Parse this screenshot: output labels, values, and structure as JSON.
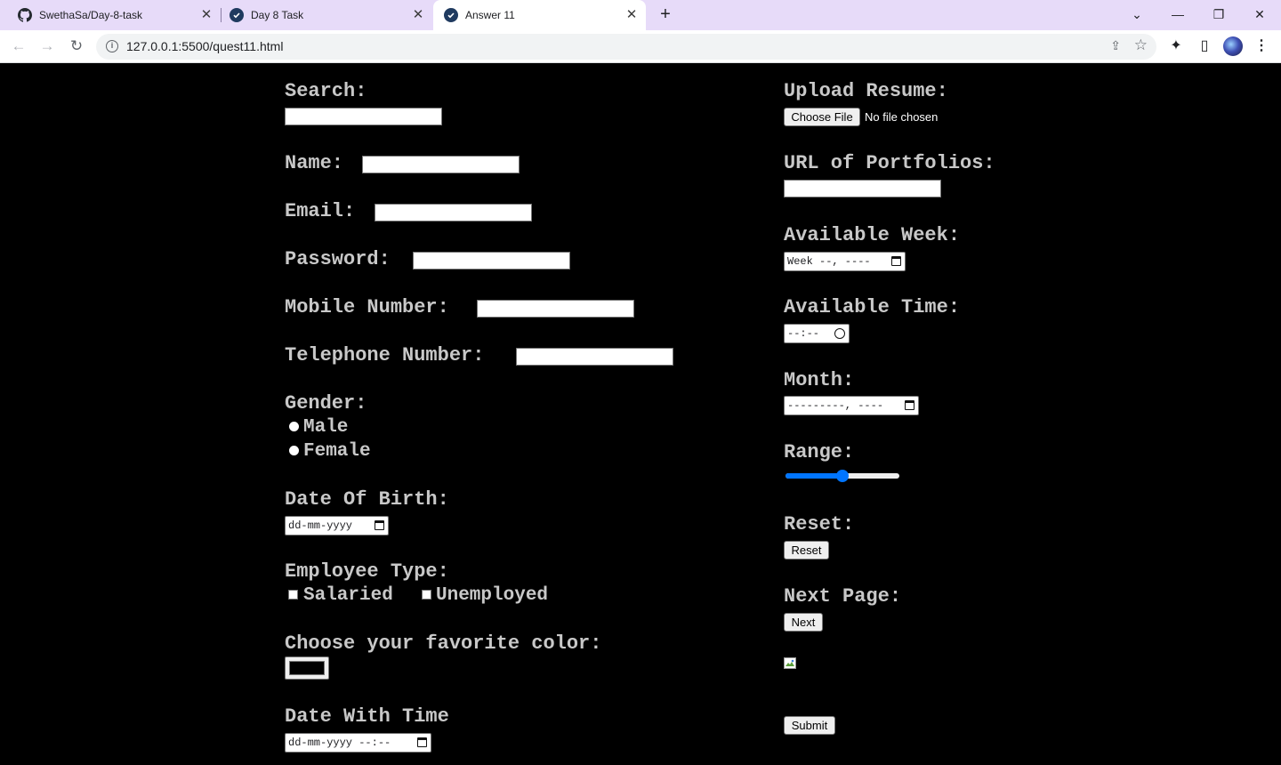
{
  "browser": {
    "tabs": [
      {
        "title": "SwethaSa/Day-8-task",
        "active": false
      },
      {
        "title": "Day 8 Task",
        "active": false
      },
      {
        "title": "Answer 11",
        "active": true
      }
    ],
    "url": "127.0.0.1:5500/quest11.html",
    "accent": "#e7dbf9"
  },
  "form": {
    "search_label": "Search:",
    "name_label": "Name:",
    "email_label": "Email:",
    "password_label": "Password:",
    "mobile_label": "Mobile Number:",
    "telephone_label": "Telephone Number:",
    "gender_label": "Gender:",
    "gender_options": [
      "Male",
      "Female"
    ],
    "dob_label": "Date Of Birth:",
    "dob_placeholder": "dd-mm-yyyy",
    "employee_label": "Employee Type:",
    "employee_options": [
      "Salaried",
      "Unemployed"
    ],
    "color_label": "Choose your favorite color:",
    "color_value": "#000000",
    "datetime_label": "Date With Time",
    "datetime_placeholder": "dd-mm-yyyy --:--",
    "resume_label": "Upload Resume:",
    "choose_file_label": "Choose File",
    "file_status": "No file chosen",
    "portfolio_label": "URL of Portfolios:",
    "week_label": "Available Week:",
    "week_placeholder": "Week --, ----",
    "time_label": "Available Time:",
    "time_placeholder": "--:--",
    "month_label": "Month:",
    "month_placeholder": "---------, ----",
    "range_label": "Range:",
    "range_value": 0.5,
    "reset_label": "Reset:",
    "reset_button": "Reset",
    "next_label": "Next Page:",
    "next_button": "Next",
    "submit_button": "Submit"
  }
}
